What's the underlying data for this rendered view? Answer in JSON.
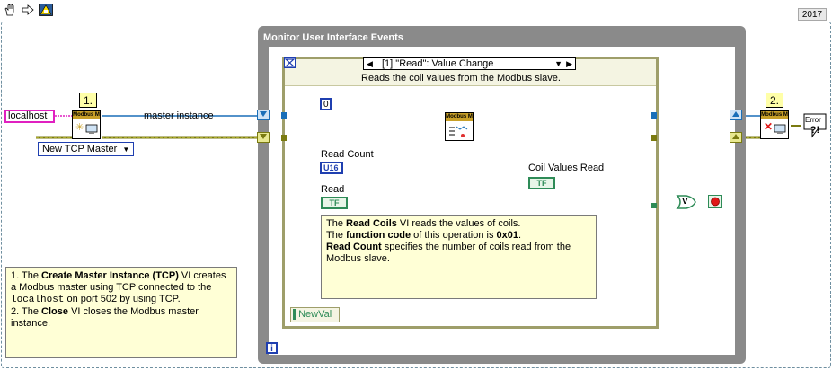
{
  "version": "2017",
  "toolbar": {
    "run_label": "",
    "arrow_label": "",
    "highlight_label": ""
  },
  "loop_title": "Monitor User Interface Events",
  "event_structure": {
    "selector": "[1] \"Read\": Value Change",
    "description": "Reads the coil values from the Modbus slave.",
    "newval_label": "NewVal",
    "iteration_label": "i"
  },
  "create_master": {
    "address_value": "localhost",
    "wire_label": "master instance",
    "step_number": "1.",
    "icon_title": "Modbus M",
    "type_selector": "New TCP Master"
  },
  "read_coils": {
    "icon_title": "Modbus M",
    "start_constant": "0",
    "read_count_label": "Read Count",
    "read_count_type": "U16",
    "read_label": "Read",
    "read_type": "TF",
    "coil_values_label": "Coil Values Read",
    "coil_values_type": "TF"
  },
  "close": {
    "step_number": "2.",
    "icon_title": "Modbus M",
    "error_label": "Error"
  },
  "stop_gate": "V",
  "inner_note": {
    "line1_pre": "The ",
    "line1_bold": "Read Coils",
    "line1_post": " VI reads the values of coils.",
    "line2_pre": "The ",
    "line2_bold": "function code",
    "line2_mid": " of this operation is ",
    "line2_code": "0x01",
    "line2_post": ".",
    "line3_bold": "Read Count",
    "line3_post": " specifies the number of coils read from the Modbus slave."
  },
  "outer_note": {
    "p1_pre": "1. The ",
    "p1_bold": "Create Master Instance (TCP)",
    "p1_post": " VI creates a Modbus master using TCP connected to the ",
    "p1_code": "localhost",
    "p1_end": " on port 502 by using TCP.",
    "p2_pre": "2. The ",
    "p2_bold": "Close",
    "p2_post": " VI closes the Modbus master instance."
  }
}
